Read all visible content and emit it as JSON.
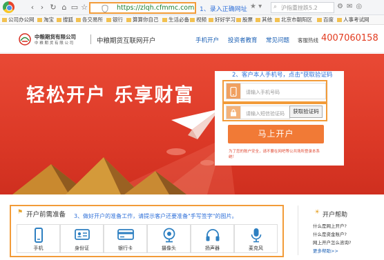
{
  "browser": {
    "url": "https://zlqh.cfmmc.com",
    "search_placeholder": "沪指重挫跌5.2",
    "bookmarks": [
      "公司办公网",
      "淘宝",
      "搜狐",
      "各交易所",
      "银行",
      "算算你自己",
      "生活必备",
      "视频",
      "好好学习",
      "股票",
      "其他",
      "北京市朝阳区",
      "百度",
      "人事考试网"
    ]
  },
  "annotations": {
    "step1": "1、录入正确网址",
    "step2": "2、客户本人手机号，点击\"获取验证码",
    "step3": "3、做好开户的准备工作，请提示客户还要准备\"手写签字\"的图片。"
  },
  "header": {
    "company_cn": "中粮期货有限公司",
    "company_en": "中 粮 期 货 有 限 公 司",
    "site_title": "中粮期货互联网开户",
    "nav": [
      "手机开户",
      "投资者教育",
      "常见问题"
    ],
    "hotline_label": "客服热线",
    "hotline": "4007060158"
  },
  "banner": {
    "slogan": "轻松开户  乐享财富"
  },
  "form": {
    "phone_placeholder": "请输入手机号码",
    "code_placeholder": "请输入短信验证码",
    "get_code": "获取验证码",
    "submit": "马上开户",
    "note": "为了您的账户安全，请不要在网吧等公共场所登录本系统！"
  },
  "prep": {
    "title": "开户前需准备",
    "items": [
      "手机",
      "身份证",
      "银行卡",
      "摄像头",
      "扬声器",
      "麦克风"
    ]
  },
  "help": {
    "title": "开户帮助",
    "links": [
      "什么是网上开户?",
      "什么是资金账户?",
      "网上开户怎么咨询?"
    ],
    "more": "更多帮助>>"
  },
  "colors": {
    "accent_orange": "#f17a36",
    "banner_red": "#e14232",
    "annotation_blue": "#2e6fd8",
    "highlight_orange": "#f29b38",
    "hotline_red": "#e23a1e"
  }
}
